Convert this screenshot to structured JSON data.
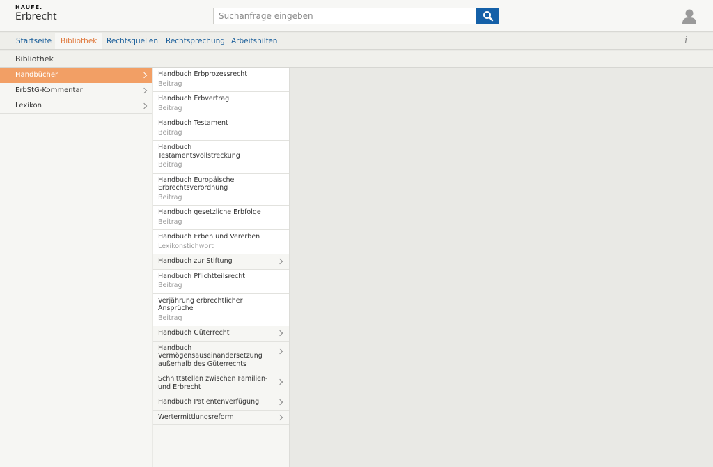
{
  "header": {
    "brand": "HAUFE.",
    "product": "Erbrecht",
    "search_placeholder": "Suchanfrage eingeben",
    "search_icon": "search-icon",
    "user_icon": "user-icon"
  },
  "nav": {
    "tabs": [
      "Startseite",
      "Bibliothek",
      "Rechtsquellen",
      "Rechtsprechung",
      "Arbeitshilfen"
    ],
    "active": "Bibliothek",
    "info_label": "i"
  },
  "page": {
    "title": "Bibliothek"
  },
  "categories": [
    {
      "label": "Handbücher",
      "active": true
    },
    {
      "label": "ErbStG-Kommentar",
      "active": false
    },
    {
      "label": "Lexikon",
      "active": false
    }
  ],
  "items": [
    {
      "title": "Handbuch Erbprozessrecht",
      "subtitle": "Beitrag"
    },
    {
      "title": "Handbuch Erbvertrag",
      "subtitle": "Beitrag"
    },
    {
      "title": "Handbuch Testament",
      "subtitle": "Beitrag"
    },
    {
      "title": "Handbuch Testamentsvollstreckung",
      "subtitle": "Beitrag"
    },
    {
      "title": "Handbuch Europäische Erbrechtsverordnung",
      "subtitle": "Beitrag"
    },
    {
      "title": "Handbuch gesetzliche Erbfolge",
      "subtitle": "Beitrag"
    },
    {
      "title": "Handbuch Erben und Vererben",
      "subtitle": "Lexikonstichwort"
    },
    {
      "title": "Handbuch zur Stiftung",
      "subtitle": ""
    },
    {
      "title": "Handbuch Pflichtteilsrecht",
      "subtitle": "Beitrag"
    },
    {
      "title": "Verjährung erbrechtlicher Ansprüche",
      "subtitle": "Beitrag"
    },
    {
      "title": "Handbuch Güterrecht",
      "subtitle": ""
    },
    {
      "title": "Handbuch Vermögensauseinandersetzung außerhalb des Güterrechts",
      "subtitle": ""
    },
    {
      "title": "Schnittstellen zwischen Familien- und Erbrecht",
      "subtitle": ""
    },
    {
      "title": "Handbuch Patientenverfügung",
      "subtitle": ""
    },
    {
      "title": "Wertermittlungsreform",
      "subtitle": ""
    }
  ],
  "colors": {
    "accent": "#e07a3e",
    "active_bg": "#f29f65",
    "link": "#1a5e9a",
    "search_button": "#1460a8"
  }
}
